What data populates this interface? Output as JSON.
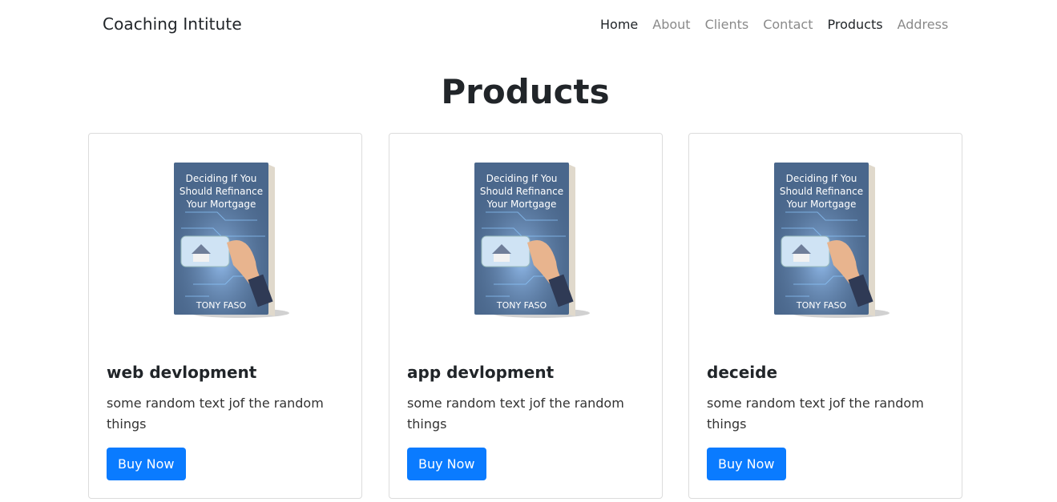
{
  "navbar": {
    "brand": "Coaching Intitute",
    "links": [
      {
        "label": "Home",
        "active": true
      },
      {
        "label": "About",
        "active": false
      },
      {
        "label": "Clients",
        "active": false
      },
      {
        "label": "Contact",
        "active": false
      },
      {
        "label": "Products",
        "active": true
      },
      {
        "label": "Address",
        "active": false
      }
    ]
  },
  "page": {
    "title": "Products"
  },
  "book_cover": {
    "title_lines": [
      "Deciding If You",
      "Should Refinance",
      "Your Mortgage"
    ],
    "author": "TONY FASO"
  },
  "cards": [
    {
      "title": "web devlopment",
      "text": "some random text jof the random things",
      "button": "Buy Now"
    },
    {
      "title": "app devlopment",
      "text": "some random text jof the random things",
      "button": "Buy Now"
    },
    {
      "title": "deceide",
      "text": "some random text jof the random things",
      "button": "Buy Now"
    }
  ],
  "colors": {
    "primary": "#0a7bff",
    "nav_active": "#212529",
    "nav_muted": "#8a8a8a"
  }
}
